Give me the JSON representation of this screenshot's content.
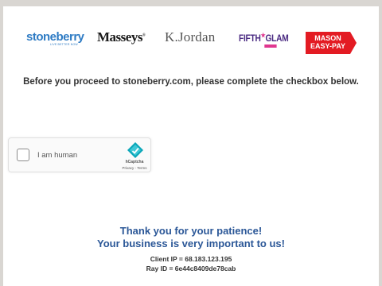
{
  "brands": {
    "stoneberry": {
      "name": "stoneberry",
      "tagline": "LIVE BETTER NOW"
    },
    "masseys": "Masseys",
    "kjordan": "K.Jordan",
    "fifth_glam": {
      "fifth": "FIFTH",
      "glam": "GLAM"
    },
    "mason": {
      "line1": "MASON",
      "line2": "EASY-PAY"
    }
  },
  "notice": "Before you proceed to stoneberry.com, please complete the checkbox below.",
  "captcha": {
    "label": "I am human",
    "brand": "hCaptcha",
    "links": "Privacy - Terms"
  },
  "thanks": {
    "line1": "Thank you for your patience!",
    "line2": "Your business is very important to us!"
  },
  "info": {
    "client_ip": "Client IP = 68.183.123.195",
    "ray_id": "Ray ID = 6e44c8409de78cab"
  },
  "colors": {
    "stoneberry_blue": "#2e7bc4",
    "mason_red": "#e31b23",
    "fifth_purple": "#4a2a82",
    "glam_pink": "#e0368f",
    "thanks_blue": "#2b5797"
  }
}
